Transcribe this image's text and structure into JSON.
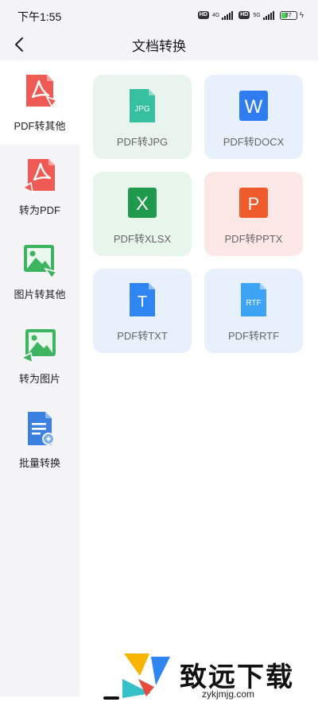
{
  "status_bar": {
    "time": "下午1:55",
    "hd1": "HD",
    "net1": "4G",
    "hd2": "HD",
    "net2": "5G",
    "battery": "37"
  },
  "header": {
    "title": "文档转换",
    "back_icon": "chevron-left-icon"
  },
  "sidebar": {
    "items": [
      {
        "label": "PDF转其他",
        "icon": "pdf-export-icon",
        "active": true
      },
      {
        "label": "转为PDF",
        "icon": "pdf-import-icon",
        "active": false
      },
      {
        "label": "图片转其他",
        "icon": "image-export-icon",
        "active": false
      },
      {
        "label": "转为图片",
        "icon": "image-import-icon",
        "active": false
      },
      {
        "label": "批量转换",
        "icon": "batch-document-icon",
        "active": false
      }
    ]
  },
  "grid": {
    "cards": [
      {
        "label": "PDF转JPG",
        "icon": "jpg-file-icon",
        "icon_text": "JPG"
      },
      {
        "label": "PDF转DOCX",
        "icon": "word-icon",
        "icon_text": "W"
      },
      {
        "label": "PDF转XLSX",
        "icon": "excel-icon",
        "icon_text": "X"
      },
      {
        "label": "PDF转PPTX",
        "icon": "powerpoint-icon",
        "icon_text": "P"
      },
      {
        "label": "PDF转TXT",
        "icon": "txt-file-icon",
        "icon_text": "T"
      },
      {
        "label": "PDF转RTF",
        "icon": "rtf-file-icon",
        "icon_text": "RTF"
      }
    ]
  },
  "watermark": {
    "text": "致远下载",
    "url": "zykjmjg.com"
  },
  "colors": {
    "pdf_red": "#f05a55",
    "image_green": "#3db560",
    "batch_blue": "#3b7fe0",
    "jpg_teal": "#36c0a0",
    "word_blue": "#2f7cf0",
    "excel_green": "#1f9a4c",
    "ppt_orange": "#ee5a2a",
    "txt_blue": "#2f86f3",
    "rtf_blue": "#3ca3f5"
  }
}
